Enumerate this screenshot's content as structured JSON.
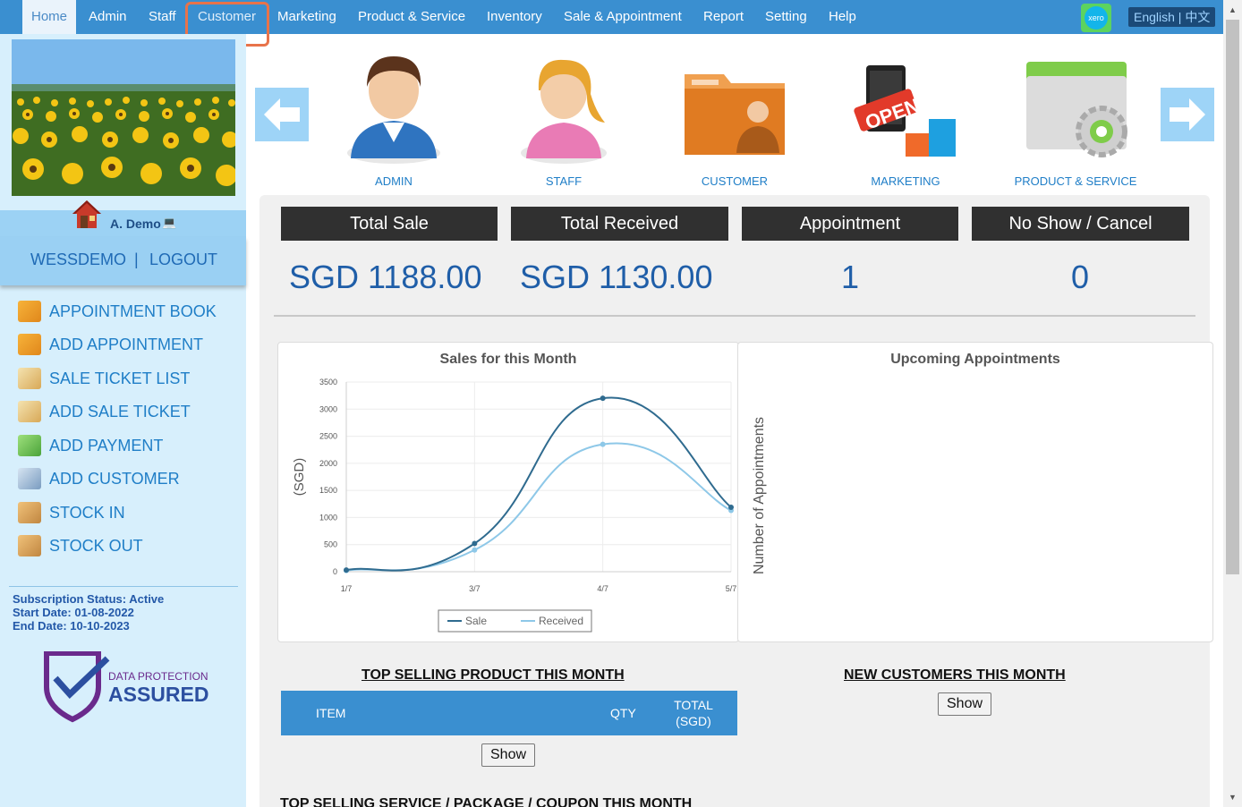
{
  "nav": {
    "items": [
      "Home",
      "Admin",
      "Staff",
      "Customer",
      "Marketing",
      "Product & Service",
      "Inventory",
      "Sale & Appointment",
      "Report",
      "Setting",
      "Help"
    ],
    "xero_label": "xero",
    "language": "English | 中文"
  },
  "sidebar": {
    "user_name": "A. Demo",
    "company_link": "WESSDEMO",
    "separator": "|",
    "logout": "LOGOUT",
    "menu": [
      "APPOINTMENT BOOK",
      "ADD APPOINTMENT",
      "SALE TICKET LIST",
      "ADD SALE TICKET",
      "ADD PAYMENT",
      "ADD CUSTOMER",
      "STOCK IN",
      "STOCK OUT"
    ],
    "subscription_status": "Subscription Status: Active",
    "start_date": "Start Date: 01-08-2022",
    "end_date": "End Date: 10-10-2023",
    "dp_line1": "DATA PROTECTION",
    "dp_line2": "ASSURED"
  },
  "modules": [
    "ADMIN",
    "STAFF",
    "CUSTOMER",
    "MARKETING",
    "PRODUCT & SERVICE"
  ],
  "stats": {
    "headers": [
      "Total Sale",
      "Total Received",
      "Appointment",
      "No Show / Cancel"
    ],
    "values": [
      "SGD 1188.00",
      "SGD 1130.00",
      "1",
      "0"
    ]
  },
  "sales_chart_title": "Sales for this Month",
  "appointments_title": "Upcoming Appointments",
  "appointments_ylabel": "Number of Appointments",
  "chart_data": {
    "type": "line",
    "title": "Sales for this Month",
    "xlabel": "",
    "ylabel": "(SGD)",
    "x": [
      "1/7",
      "3/7",
      "4/7",
      "5/7"
    ],
    "yticks": [
      0,
      500,
      1000,
      1500,
      2000,
      2500,
      3000,
      3500
    ],
    "ylim": [
      0,
      3500
    ],
    "grid": true,
    "legend": "bottom",
    "series": [
      {
        "name": "Sale",
        "color": "#2f6b8f",
        "values": [
          30,
          520,
          3200,
          1188
        ]
      },
      {
        "name": "Received",
        "color": "#8ec8e8",
        "values": [
          20,
          400,
          2350,
          1130
        ]
      }
    ]
  },
  "top_products": {
    "title": "TOP SELLING PRODUCT THIS MONTH",
    "columns": [
      "ITEM",
      "QTY",
      "TOTAL",
      "(SGD)"
    ],
    "show_label": "Show"
  },
  "new_customers": {
    "title": "NEW CUSTOMERS THIS MONTH",
    "show_label": "Show"
  },
  "top_services": {
    "title": "TOP SELLING SERVICE / PACKAGE / COUPON THIS MONTH"
  }
}
